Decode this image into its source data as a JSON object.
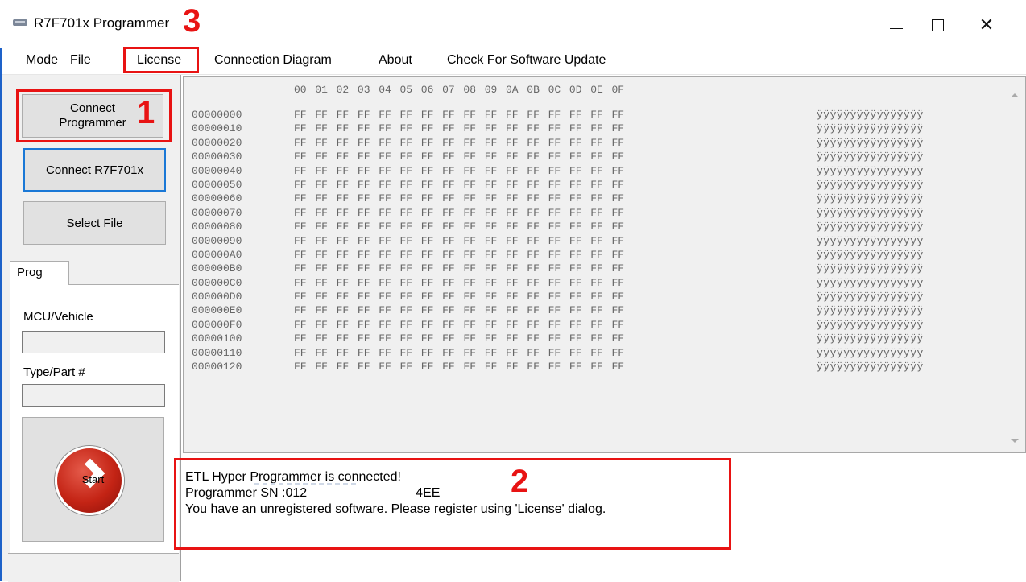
{
  "window": {
    "title": "R7F701x Programmer",
    "controls": {
      "minimize": "",
      "maximize": "",
      "close": "✕"
    }
  },
  "annotations": {
    "one": "1",
    "two": "2",
    "three": "3"
  },
  "menu": {
    "items": [
      "Mode",
      "File",
      "License",
      "Connection Diagram",
      "About",
      "Check For Software Update"
    ]
  },
  "left_panel": {
    "connect_programmer_line1": "Connect",
    "connect_programmer_line2": "Programmer",
    "connect_mcu": "Connect R7F701x",
    "select_file": "Select File",
    "tab": "Prog",
    "mcu_label": "MCU/Vehicle",
    "mcu_value": "",
    "type_label": "Type/Part #",
    "type_value": "",
    "start_label": "Start"
  },
  "hex_view": {
    "columns": [
      "00",
      "01",
      "02",
      "03",
      "04",
      "05",
      "06",
      "07",
      "08",
      "09",
      "0A",
      "0B",
      "0C",
      "0D",
      "0E",
      "0F"
    ],
    "rows": [
      {
        "addr": "00000000",
        "ascii": "ÿÿÿÿÿÿÿÿÿÿÿÿÿÿÿÿ"
      },
      {
        "addr": "00000010",
        "ascii": "ÿÿÿÿÿÿÿÿÿÿÿÿÿÿÿÿ"
      },
      {
        "addr": "00000020",
        "ascii": "ÿÿÿÿÿÿÿÿÿÿÿÿÿÿÿÿ"
      },
      {
        "addr": "00000030",
        "ascii": "ÿÿÿÿÿÿÿÿÿÿÿÿÿÿÿÿ"
      },
      {
        "addr": "00000040",
        "ascii": "ÿÿÿÿÿÿÿÿÿÿÿÿÿÿÿÿ"
      },
      {
        "addr": "00000050",
        "ascii": "ÿÿÿÿÿÿÿÿÿÿÿÿÿÿÿÿ"
      },
      {
        "addr": "00000060",
        "ascii": "ÿÿÿÿÿÿÿÿÿÿÿÿÿÿÿÿ"
      },
      {
        "addr": "00000070",
        "ascii": "ÿÿÿÿÿÿÿÿÿÿÿÿÿÿÿÿ"
      },
      {
        "addr": "00000080",
        "ascii": "ÿÿÿÿÿÿÿÿÿÿÿÿÿÿÿÿ"
      },
      {
        "addr": "00000090",
        "ascii": "ÿÿÿÿÿÿÿÿÿÿÿÿÿÿÿÿ"
      },
      {
        "addr": "000000A0",
        "ascii": "ÿÿÿÿÿÿÿÿÿÿÿÿÿÿÿÿ"
      },
      {
        "addr": "000000B0",
        "ascii": "ÿÿÿÿÿÿÿÿÿÿÿÿÿÿÿÿ"
      },
      {
        "addr": "000000C0",
        "ascii": "ÿÿÿÿÿÿÿÿÿÿÿÿÿÿÿÿ"
      },
      {
        "addr": "000000D0",
        "ascii": "ÿÿÿÿÿÿÿÿÿÿÿÿÿÿÿÿ"
      },
      {
        "addr": "000000E0",
        "ascii": "ÿÿÿÿÿÿÿÿÿÿÿÿÿÿÿÿ"
      },
      {
        "addr": "000000F0",
        "ascii": "ÿÿÿÿÿÿÿÿÿÿÿÿÿÿÿÿ"
      },
      {
        "addr": "00000100",
        "ascii": "ÿÿÿÿÿÿÿÿÿÿÿÿÿÿÿÿ"
      },
      {
        "addr": "00000110",
        "ascii": "ÿÿÿÿÿÿÿÿÿÿÿÿÿÿÿÿ"
      },
      {
        "addr": "00000120",
        "ascii": "ÿÿÿÿÿÿÿÿÿÿÿÿÿÿÿÿ"
      }
    ],
    "byte_value": "FF"
  },
  "log": {
    "line1": "ETL Hyper Programmer is connected!",
    "line2_prefix": "Programmer SN :012",
    "line2_suffix": "4EE",
    "line3": "You have an unregistered software. Please register using 'License' dialog."
  },
  "colors": {
    "annotation": "#e81313",
    "focus_border": "#1a78d6",
    "start_button": "#c42415"
  }
}
